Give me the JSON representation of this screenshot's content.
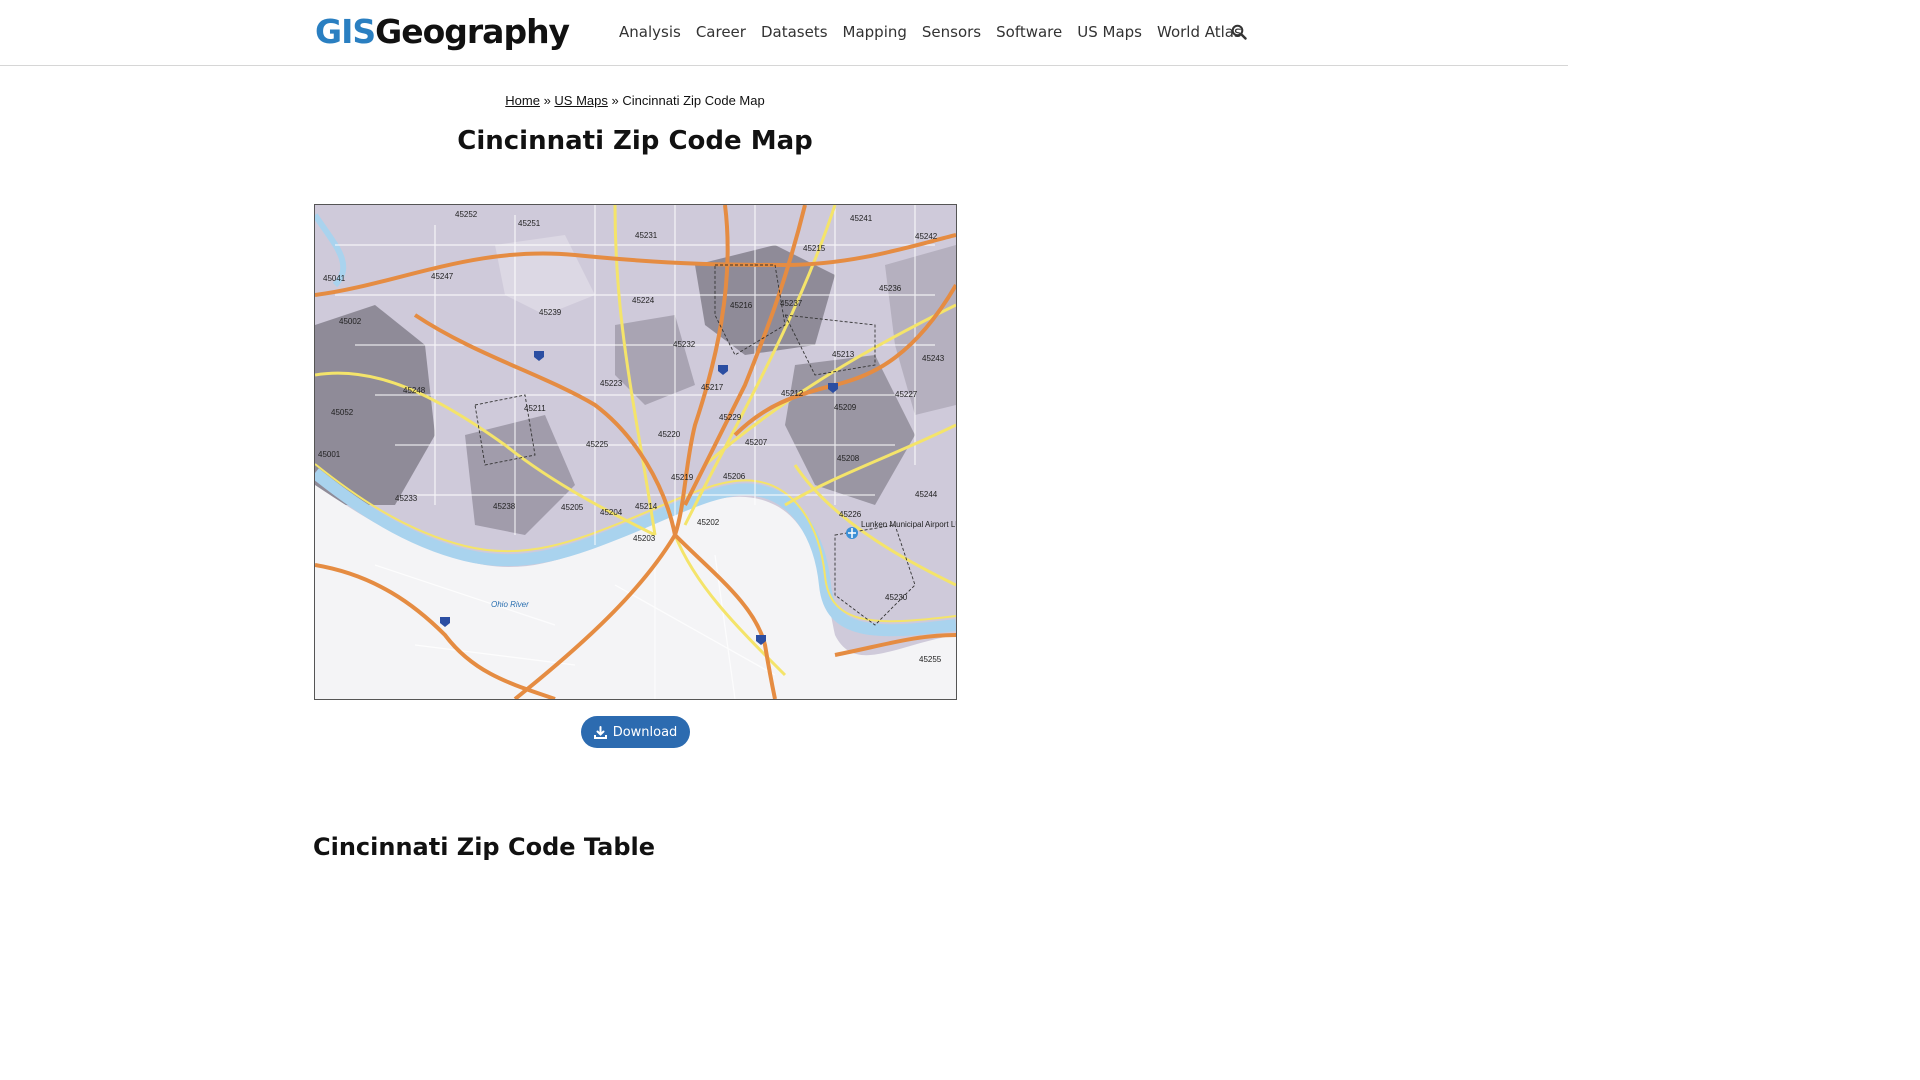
{
  "site": {
    "logo_gis": "GIS",
    "logo_geography": "Geography"
  },
  "nav": [
    {
      "label": "Analysis"
    },
    {
      "label": "Career"
    },
    {
      "label": "Datasets"
    },
    {
      "label": "Mapping"
    },
    {
      "label": "Sensors"
    },
    {
      "label": "Software"
    },
    {
      "label": "US Maps"
    },
    {
      "label": "World Atlas"
    }
  ],
  "icons": {
    "search": "search-icon",
    "download": "download-icon"
  },
  "breadcrumb": {
    "home": "Home",
    "separator": "»",
    "us_maps": "US Maps",
    "current": "Cincinnati Zip Code Map"
  },
  "page": {
    "title": "Cincinnati Zip Code Map",
    "download_label": "Download",
    "section_title": "Cincinnati Zip Code Table"
  },
  "map": {
    "river_label": "Ohio River",
    "airport_label": "Lunken Municipal Airport LUK",
    "zip_labels": [
      "45252",
      "45251",
      "45231",
      "45241",
      "45215",
      "45242",
      "45041",
      "45247",
      "45224",
      "45236",
      "45002",
      "45239",
      "45216",
      "45237",
      "45232",
      "45213",
      "45243",
      "45248",
      "45223",
      "45217",
      "45212",
      "45227",
      "45052",
      "45211",
      "45229",
      "45209",
      "45220",
      "45001",
      "45225",
      "45207",
      "45208",
      "45206",
      "45219",
      "45233",
      "45238",
      "45205",
      "45204",
      "45214",
      "45244",
      "45202",
      "45226",
      "45203",
      "45230",
      "45255"
    ]
  },
  "colors": {
    "brand_blue": "#2a7fc1",
    "button_blue": "#2c6bb0"
  }
}
